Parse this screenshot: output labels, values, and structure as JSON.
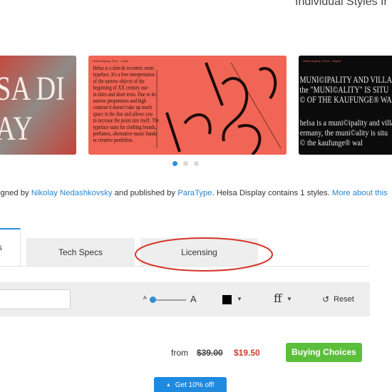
{
  "header": {
    "title": "Individual Styles fr"
  },
  "carousel": {
    "slides": [
      {
        "text_lines": [
          "SA DI",
          "AY"
        ]
      },
      {
        "caption": "Helsa Display, 30 pt · 1 style",
        "body_lines": [
          "Helsa is a slim & eccentric semi-",
          "typeface. It's a free interpretation",
          "of the narrow objects of the",
          "beginning of XX century use-",
          "in titles and short texts. Due to its",
          "narrow proportions and high",
          "contrast it doesn't take up much",
          "space in the line and allows you",
          "to increase the point size itself. The",
          "typeface suits for clothing brands,",
          "perfumes, alternative music bands",
          "or creative portfolios."
        ]
      },
      {
        "caption": "Helsa Display, 100 pt · Glyphs",
        "display_lines": [
          "MUNI©IPALITY AND VILLAGO",
          "the \"MUNI©ALITY\" IS SITU",
          "© OF THE KAUFUNGE® WALL"
        ],
        "body_lines": [
          "helsa is a muni©ipality and villag",
          "ermany, the muni©ality is situ",
          "© the kaufunge® wal"
        ]
      }
    ],
    "active_index": 0,
    "dot_count": 3
  },
  "description": {
    "prefix": "igned by ",
    "designer": "Nikolay Nedashkovsky",
    "middle": " and published by ",
    "publisher": "ParaType",
    "suffix": ". Helsa Display contains 1 styles. ",
    "more_link": "More about this"
  },
  "tabs": {
    "active_fragment": "s",
    "tech_specs": "Tech Specs",
    "licensing": "Licensing"
  },
  "toolbar": {
    "sample_text_value": "",
    "size_small_glyph": "A",
    "size_large_glyph": "A",
    "color_value": "#000000",
    "ligature_glyph": "ff",
    "reset_label": "Reset",
    "reset_icon": "reset-icon"
  },
  "pricing": {
    "from_label": "from",
    "old_price": "$39.00",
    "new_price": "$19.50",
    "buy_label": "Buying Choices"
  },
  "promo": {
    "label": "Get 10% off!"
  },
  "colors": {
    "accent_blue": "#2f8fd6",
    "sale_red": "#d33a2c",
    "buy_green": "#5cbf3c",
    "annotation_red": "#d6352a",
    "slide_coral": "#f06555"
  }
}
